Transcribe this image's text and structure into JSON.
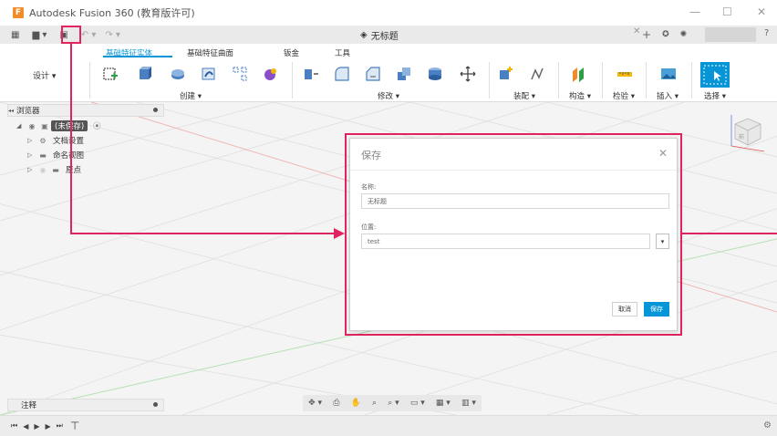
{
  "window": {
    "logo": "F",
    "title": "Autodesk Fusion 360 (教育版许可)",
    "controls": [
      "—",
      "☐",
      "✕"
    ]
  },
  "qat": {
    "data_panel": "▦",
    "file": "▆ ▾",
    "save": "▣",
    "undo": "↶ ▾",
    "redo": "↷ ▾",
    "doc_title": "无标题",
    "doc_close": "✕",
    "new_tab": "+",
    "extensions": "✪",
    "notifications": "✺",
    "help": "?"
  },
  "ribbon": {
    "tabs": [
      "基础特征实体",
      "基础特征曲面",
      "钣金",
      "工具"
    ],
    "workspace": "设计 ▾",
    "groups": [
      "创建 ▾",
      "修改 ▾",
      "装配 ▾",
      "构造 ▾",
      "检验 ▾",
      "插入 ▾",
      "选择 ▾"
    ]
  },
  "browser": {
    "title": "浏览器",
    "collapse": "◂◂",
    "root": "(未保存)",
    "items": [
      "文档设置",
      "命名视图",
      "原点"
    ]
  },
  "comments": {
    "title": "注释"
  },
  "navbar": {
    "items": [
      "✥ ▾",
      "⎙",
      "✋",
      "⌕",
      "⌕ ▾",
      "▭ ▾",
      "▦ ▾",
      "▥ ▾"
    ]
  },
  "timeline": {
    "controls": [
      "⏮",
      "◀",
      "▶",
      "▶",
      "⏭"
    ],
    "marker": "⊤",
    "settings": "⚙"
  },
  "viewcube": {
    "face": "前"
  },
  "dialog": {
    "title": "保存",
    "close": "✕",
    "name_label": "名称:",
    "name_value": "无标题",
    "location_label": "位置:",
    "location_value": "test",
    "dropdown": "▾",
    "cancel": "取消",
    "save": "保存"
  },
  "colors": {
    "accent": "#0696d7",
    "highlight": "#e0245e",
    "logo": "#f28c28"
  }
}
